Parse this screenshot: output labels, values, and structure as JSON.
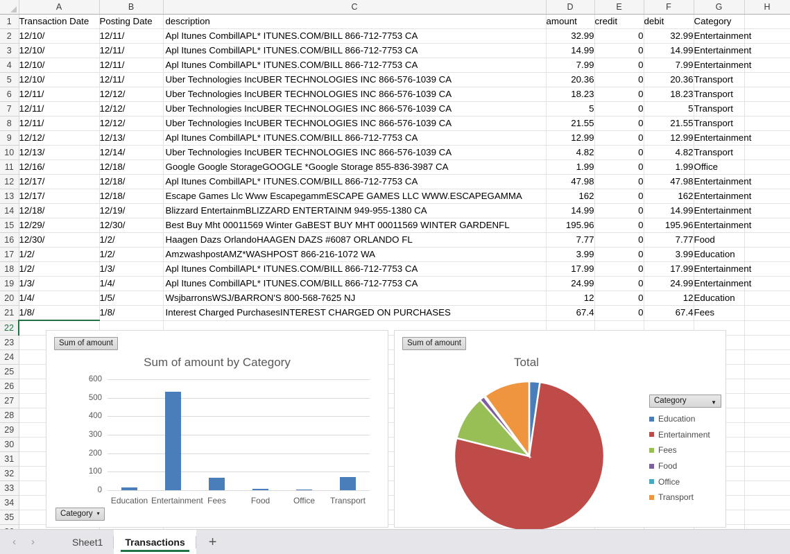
{
  "app": {
    "name": "Excel Worksheet"
  },
  "grid": {
    "columns": [
      "A",
      "B",
      "C",
      "D",
      "E",
      "F",
      "G",
      "H"
    ],
    "headers": [
      "Transaction Date",
      "Posting Date",
      "description",
      "amount",
      "credit",
      "debit",
      "Category"
    ],
    "selected_row": 22,
    "rows": [
      [
        "12/10/",
        "12/11/",
        "Apl Itunes CombillAPL* ITUNES.COM/BILL 866-712-7753 CA",
        "32.99",
        "0",
        "32.99",
        "Entertainment"
      ],
      [
        "12/10/",
        "12/11/",
        "Apl Itunes CombillAPL* ITUNES.COM/BILL 866-712-7753 CA",
        "14.99",
        "0",
        "14.99",
        "Entertainment"
      ],
      [
        "12/10/",
        "12/11/",
        "Apl Itunes CombillAPL* ITUNES.COM/BILL 866-712-7753 CA",
        "7.99",
        "0",
        "7.99",
        "Entertainment"
      ],
      [
        "12/10/",
        "12/11/",
        "Uber Technologies IncUBER TECHNOLOGIES INC 866-576-1039 CA",
        "20.36",
        "0",
        "20.36",
        "Transport"
      ],
      [
        "12/11/",
        "12/12/",
        "Uber Technologies IncUBER TECHNOLOGIES INC 866-576-1039 CA",
        "18.23",
        "0",
        "18.23",
        "Transport"
      ],
      [
        "12/11/",
        "12/12/",
        "Uber Technologies IncUBER TECHNOLOGIES INC 866-576-1039 CA",
        "5",
        "0",
        "5",
        "Transport"
      ],
      [
        "12/11/",
        "12/12/",
        "Uber Technologies IncUBER TECHNOLOGIES INC 866-576-1039 CA",
        "21.55",
        "0",
        "21.55",
        "Transport"
      ],
      [
        "12/12/",
        "12/13/",
        "Apl Itunes CombillAPL* ITUNES.COM/BILL 866-712-7753 CA",
        "12.99",
        "0",
        "12.99",
        "Entertainment"
      ],
      [
        "12/13/",
        "12/14/",
        "Uber Technologies IncUBER TECHNOLOGIES INC 866-576-1039 CA",
        "4.82",
        "0",
        "4.82",
        "Transport"
      ],
      [
        "12/16/",
        "12/18/",
        "Google Google StorageGOOGLE *Google Storage 855-836-3987 CA",
        "1.99",
        "0",
        "1.99",
        "Office"
      ],
      [
        "12/17/",
        "12/18/",
        "Apl Itunes CombillAPL* ITUNES.COM/BILL 866-712-7753 CA",
        "47.98",
        "0",
        "47.98",
        "Entertainment"
      ],
      [
        "12/17/",
        "12/18/",
        "Escape Games Llc Www EscapegammESCAPE GAMES LLC WWW.ESCAPEGAMMA",
        "162",
        "0",
        "162",
        "Entertainment"
      ],
      [
        "12/18/",
        "12/19/",
        "Blizzard EntertainmBLIZZARD ENTERTAINM 949-955-1380 CA",
        "14.99",
        "0",
        "14.99",
        "Entertainment"
      ],
      [
        "12/29/",
        "12/30/",
        "Best Buy Mht 00011569 Winter GaBEST BUY MHT 00011569 WINTER GARDENFL",
        "195.96",
        "0",
        "195.96",
        "Entertainment"
      ],
      [
        "12/30/",
        "1/2/",
        "Haagen Dazs OrlandoHAAGEN DAZS #6087 ORLANDO FL",
        "7.77",
        "0",
        "7.77",
        "Food"
      ],
      [
        "1/2/",
        "1/2/",
        "AmzwashpostAMZ*WASHPOST 866-216-1072 WA",
        "3.99",
        "0",
        "3.99",
        "Education"
      ],
      [
        "1/2/",
        "1/3/",
        "Apl Itunes CombillAPL* ITUNES.COM/BILL 866-712-7753 CA",
        "17.99",
        "0",
        "17.99",
        "Entertainment"
      ],
      [
        "1/3/",
        "1/4/",
        "Apl Itunes CombillAPL* ITUNES.COM/BILL 866-712-7753 CA",
        "24.99",
        "0",
        "24.99",
        "Entertainment"
      ],
      [
        "1/4/",
        "1/5/",
        "WsjbarronsWSJ/BARRON'S 800-568-7625 NJ",
        "12",
        "0",
        "12",
        "Education"
      ],
      [
        "1/8/",
        "1/8/",
        "Interest Charged PurchasesINTEREST CHARGED ON PURCHASES",
        "67.4",
        "0",
        "67.4",
        "Fees"
      ]
    ]
  },
  "bar_chart": {
    "field_button": "Sum of amount",
    "filter_button": "Category",
    "filter_caret": "▾"
  },
  "pie_chart": {
    "field_button": "Sum of amount",
    "legend_header": "Category",
    "legend_caret": "▼"
  },
  "chart_data": [
    {
      "type": "bar",
      "title": "Sum of amount by Category",
      "xlabel": "",
      "ylabel": "",
      "categories": [
        "Education",
        "Entertainment",
        "Fees",
        "Food",
        "Office",
        "Transport"
      ],
      "values": [
        15.99,
        533.87,
        67.4,
        7.77,
        1.99,
        69.96
      ],
      "ylim": [
        0,
        600
      ],
      "yticks": [
        0,
        100,
        200,
        300,
        400,
        500,
        600
      ],
      "grid": true,
      "series_color": "#4a7ebb",
      "legend": "none"
    },
    {
      "type": "pie",
      "title": "Total",
      "labels": [
        "Education",
        "Entertainment",
        "Fees",
        "Food",
        "Office",
        "Transport"
      ],
      "values": [
        15.99,
        533.87,
        67.4,
        7.77,
        1.99,
        69.96
      ],
      "colors": [
        "#4a7ebb",
        "#be4b48",
        "#98bf56",
        "#7d60a0",
        "#46aac5",
        "#f0953f"
      ],
      "legend": "right",
      "legend_entries": [
        {
          "label": "Education",
          "color": "#4a7ebb"
        },
        {
          "label": "Entertainment",
          "color": "#be4b48"
        },
        {
          "label": "Fees",
          "color": "#98bf56"
        },
        {
          "label": "Food",
          "color": "#7d60a0"
        },
        {
          "label": "Office",
          "color": "#46aac5"
        },
        {
          "label": "Transport",
          "color": "#f0953f"
        }
      ]
    }
  ],
  "tabbar": {
    "prev": "‹",
    "next": "›",
    "add": "+",
    "sheets": [
      {
        "name": "Sheet1",
        "active": false
      },
      {
        "name": "Transactions",
        "active": true
      }
    ]
  }
}
